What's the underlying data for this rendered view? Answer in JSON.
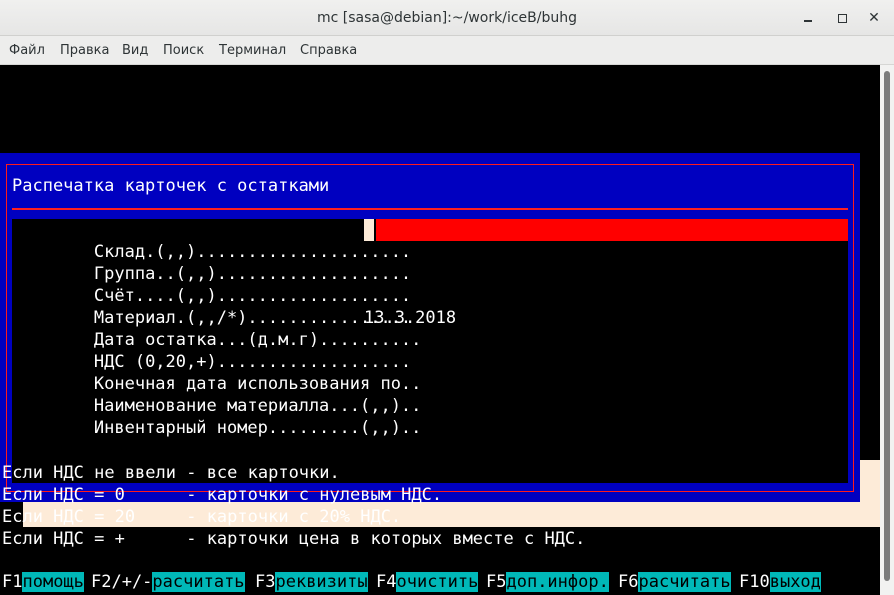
{
  "window": {
    "title": "mc [sasa@debian]:~/work/iceB/buhg"
  },
  "menu": {
    "items": [
      "Файл",
      "Правка",
      "Вид",
      "Поиск",
      "Терминал",
      "Справка"
    ]
  },
  "dialog": {
    "title": "Распечатка карточек с остатками",
    "fields": [
      {
        "label": "Склад.(,,).....................",
        "value": ""
      },
      {
        "label": "Группа..(,,)...................",
        "value": ""
      },
      {
        "label": "Счёт....(,,)...................",
        "value": ""
      },
      {
        "label": "Материал.(,,/*)................",
        "value": ""
      },
      {
        "label": "Дата остатка...(д.м.г)..........",
        "value": "13.3.2018"
      },
      {
        "label": "НДС (0,20,+)...................",
        "value": ""
      },
      {
        "label": "Конечная дата использования по..",
        "value": ""
      },
      {
        "label": "Наименование материалла...(,,)..",
        "value": ""
      },
      {
        "label": "Инвентарный номер.........(,,)..",
        "value": ""
      }
    ]
  },
  "info_lines": [
    "Если НДС не ввели - все карточки.",
    "Если НДС = 0      - карточки с нулевым НДС.",
    "Если НДС = 20     - карточки с 20% НДС.",
    "Если НДС = +      - карточки цена в которых вместе с НДС."
  ],
  "function_keys": [
    {
      "key": "F1",
      "label": "помощь"
    },
    {
      "key": "F2/+/-",
      "label": "расчитать"
    },
    {
      "key": "F3",
      "label": "реквизиты"
    },
    {
      "key": "F4",
      "label": "очистить"
    },
    {
      "key": "F5",
      "label": "доп.инфор."
    },
    {
      "key": "F6",
      "label": "расчитать"
    },
    {
      "key": "F10",
      "label": "выход"
    }
  ],
  "colors": {
    "dialog_bg": "#0000c0",
    "dialog_border": "#ff1a1a",
    "active_input": "#ff0000",
    "fkey_label_bg": "#00b8b8",
    "shadow": "#fdebd8"
  }
}
